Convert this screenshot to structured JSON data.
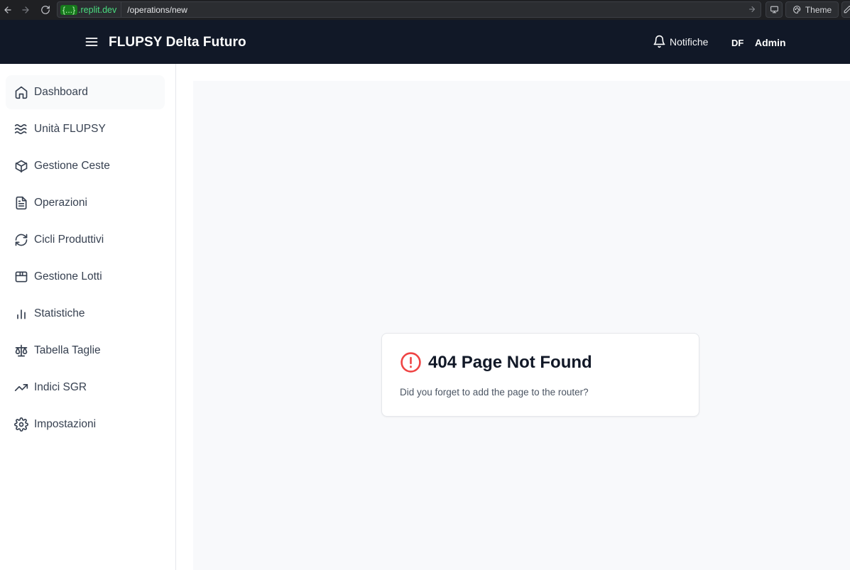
{
  "browser": {
    "url_tag": "{...}",
    "url_host": ".replit.dev",
    "url_path": "/operations/new",
    "theme_label": "Theme"
  },
  "header": {
    "title": "FLUPSY Delta Futuro",
    "notifications_label": "Notifiche",
    "avatar_initials": "DF",
    "user_name": "Admin",
    "background": "#111827"
  },
  "sidebar": {
    "items": [
      {
        "label": "Dashboard",
        "icon": "home-icon",
        "active": true
      },
      {
        "label": "Unità FLUPSY",
        "icon": "waves-icon"
      },
      {
        "label": "Gestione Ceste",
        "icon": "box-icon"
      },
      {
        "label": "Operazioni",
        "icon": "file-text-icon"
      },
      {
        "label": "Cicli Produttivi",
        "icon": "refresh-icon"
      },
      {
        "label": "Gestione Lotti",
        "icon": "package-icon"
      },
      {
        "label": "Statistiche",
        "icon": "bar-chart-icon"
      },
      {
        "label": "Tabella Taglie",
        "icon": "scale-icon"
      },
      {
        "label": "Indici SGR",
        "icon": "trending-up-icon"
      },
      {
        "label": "Impostazioni",
        "icon": "settings-icon"
      }
    ]
  },
  "main": {
    "error_title": "404 Page Not Found",
    "error_message": "Did you forget to add the page to the router?",
    "error_color": "#ef4444"
  }
}
